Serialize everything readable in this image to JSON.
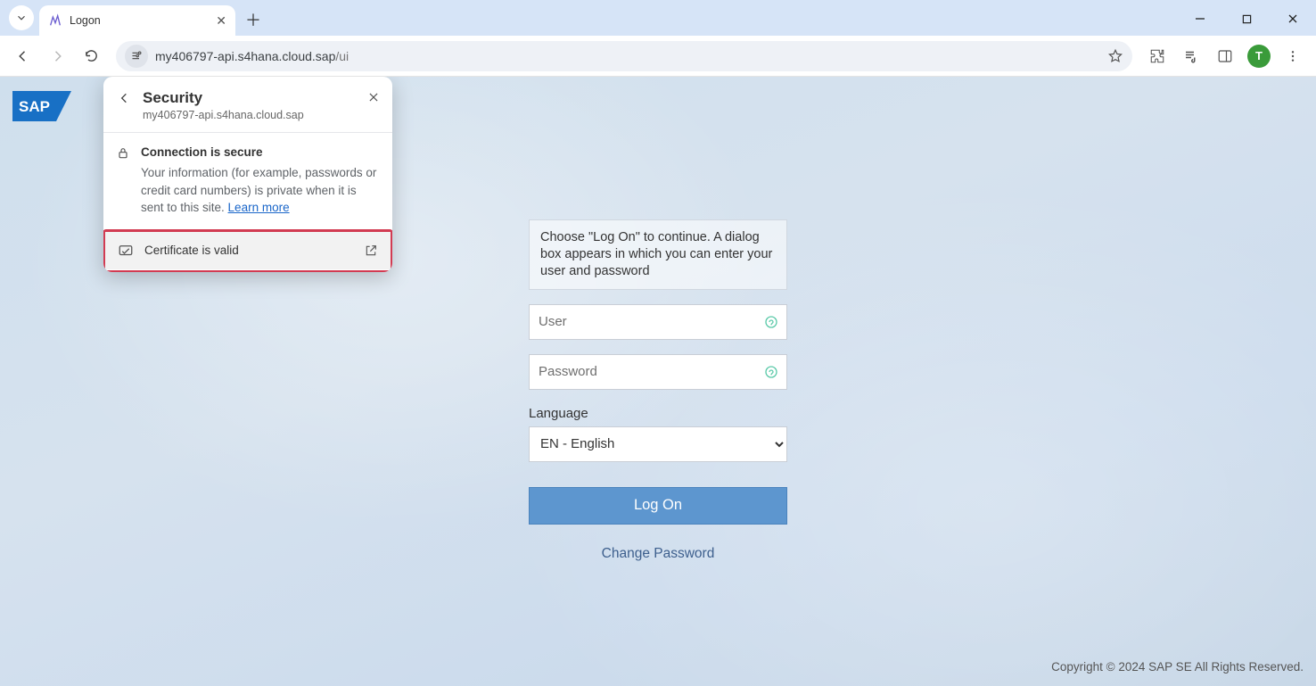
{
  "browser": {
    "tab_title": "Logon",
    "url_host": "my406797-api.s4hana.cloud.sap",
    "url_path": "/ui",
    "avatar_letter": "T"
  },
  "popover": {
    "title": "Security",
    "subtitle": "my406797-api.s4hana.cloud.sap",
    "connection_title": "Connection is secure",
    "connection_desc_1": "Your information (for example, passwords or credit card numbers) is private when it is sent to this site. ",
    "learn_more": "Learn more",
    "certificate_label": "Certificate is valid"
  },
  "login": {
    "instruction": "Choose \"Log On\" to continue. A dialog box appears in which you can enter your user and password",
    "user_placeholder": "User",
    "password_placeholder": "Password",
    "language_label": "Language",
    "language_value": "EN - English",
    "logon_label": "Log On",
    "change_password_label": "Change Password"
  },
  "footer": {
    "copyright": "Copyright © 2024 SAP SE All Rights Reserved."
  }
}
